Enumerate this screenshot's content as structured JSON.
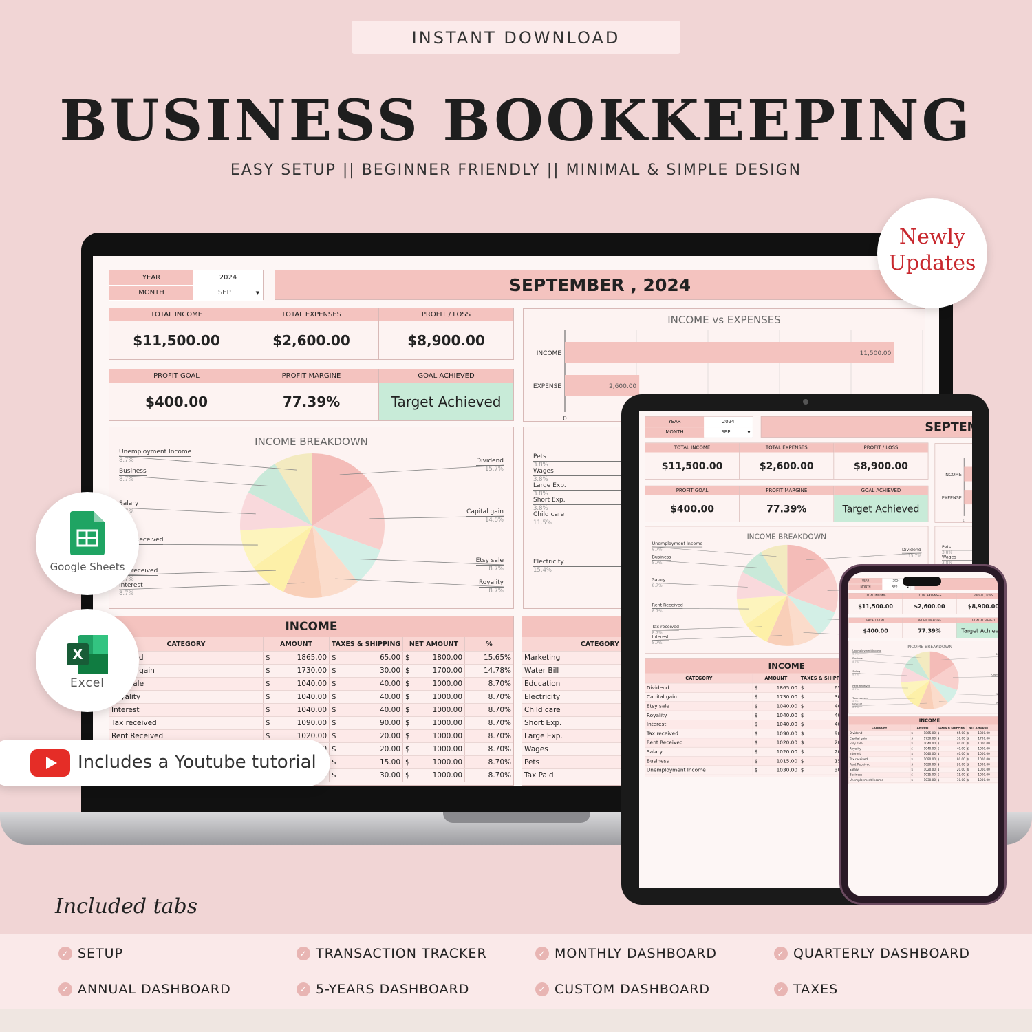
{
  "header": {
    "badge": "INSTANT  DOWNLOAD",
    "title": "BUSINESS  BOOKKEEPING",
    "subtitle": "EASY SETUP || BEGINNER FRIENDLY || MINIMAL & SIMPLE DESIGN"
  },
  "badges": {
    "newly": "Newly",
    "updates": "Updates",
    "google_sheets": "Google Sheets",
    "excel": "Excel",
    "youtube": "Includes a Youtube tutorial"
  },
  "dashboard": {
    "year_label": "YEAR",
    "year": "2024",
    "month_label": "MONTH",
    "month": "SEP",
    "title": "SEPTEMBER , 2024",
    "kpis": [
      {
        "label": "TOTAL INCOME",
        "value": "$11,500.00"
      },
      {
        "label": "TOTAL  EXPENSES",
        "value": "$2,600.00"
      },
      {
        "label": "PROFIT / LOSS",
        "value": "$8,900.00"
      },
      {
        "label": "PROFIT GOAL",
        "value": "$400.00"
      },
      {
        "label": "PROFIT MARGINE",
        "value": "77.39%"
      },
      {
        "label": "GOAL ACHIEVED",
        "value": "Target Achieved"
      }
    ],
    "colors": {
      "accent": "#f4c3bf",
      "achieved": "#c8ebd8",
      "background": "#f1d5d5"
    }
  },
  "chart_data": [
    {
      "type": "bar",
      "title": "INCOME vs EXPENSES",
      "orientation": "horizontal",
      "categories": [
        "INCOME",
        "EXPENSE"
      ],
      "values": [
        11500,
        2600
      ],
      "data_labels": [
        "11,500.00",
        "2,600.00"
      ],
      "xlim": [
        0,
        12500
      ],
      "x_tick_labels": [
        "0"
      ],
      "grid": true,
      "color": "#f4c3bf"
    },
    {
      "type": "pie",
      "title": "INCOME BREAKDOWN",
      "labels": [
        "Dividend",
        "Capital gain",
        "Etsy sale",
        "Royality",
        "Interest",
        "Tax received",
        "Rent Received",
        "Salary",
        "Business",
        "Unemployment Income"
      ],
      "values": [
        15.7,
        14.8,
        8.7,
        8.7,
        8.7,
        8.7,
        8.7,
        8.7,
        8.7,
        8.7
      ],
      "pct_labels": [
        "15.7%",
        "14.8%",
        "8.7%",
        "8.7%",
        "8.7%",
        "8.7%",
        "8.7%",
        "8.7%",
        "8.7%",
        "8.7%"
      ],
      "colors": [
        "#f4bcb8",
        "#f8cfcc",
        "#d3efe6",
        "#fbdccb",
        "#f9cfb8",
        "#fdf0a8",
        "#fdf4bd",
        "#f9d9dc",
        "#c9e9d9",
        "#f3eac0"
      ]
    },
    {
      "type": "pie",
      "title": "",
      "labels": [
        "Pets",
        "Wages",
        "Large Exp.",
        "Short Exp.",
        "Child care",
        "Electricity"
      ],
      "pct_labels": [
        "3.8%",
        "3.8%",
        "3.8%",
        "3.8%",
        "11.5%",
        "15.4%"
      ]
    }
  ],
  "income_table": {
    "title": "INCOME",
    "columns": [
      "CATEGORY",
      "AMOUNT",
      "TAXES & SHIPPING",
      "NET AMOUNT",
      "%"
    ],
    "currency": "$",
    "rows": [
      {
        "category": "Dividend",
        "amount": "1865.00",
        "taxes": "65.00",
        "net": "1800.00",
        "pct": "15.65%"
      },
      {
        "category": "Capital gain",
        "amount": "1730.00",
        "taxes": "30.00",
        "net": "1700.00",
        "pct": "14.78%"
      },
      {
        "category": "Etsy sale",
        "amount": "1040.00",
        "taxes": "40.00",
        "net": "1000.00",
        "pct": "8.70%"
      },
      {
        "category": "Royality",
        "amount": "1040.00",
        "taxes": "40.00",
        "net": "1000.00",
        "pct": "8.70%"
      },
      {
        "category": "Interest",
        "amount": "1040.00",
        "taxes": "40.00",
        "net": "1000.00",
        "pct": "8.70%"
      },
      {
        "category": "Tax received",
        "amount": "1090.00",
        "taxes": "90.00",
        "net": "1000.00",
        "pct": "8.70%"
      },
      {
        "category": "Rent Received",
        "amount": "1020.00",
        "taxes": "20.00",
        "net": "1000.00",
        "pct": "8.70%"
      },
      {
        "category": "Salary",
        "amount": "1020.00",
        "taxes": "20.00",
        "net": "1000.00",
        "pct": "8.70%"
      },
      {
        "category": "Business",
        "amount": "1015.00",
        "taxes": "15.00",
        "net": "1000.00",
        "pct": "8.70%"
      },
      {
        "category": "Unemployment Income",
        "amount": "1030.00",
        "taxes": "30.00",
        "net": "1000.00",
        "pct": "8.70%"
      }
    ]
  },
  "expense_table": {
    "column": "CATEGORY",
    "rows": [
      "Marketing",
      "Water Bill",
      "Education",
      "Electricity",
      "Child care",
      "Short Exp.",
      "Large Exp.",
      "Wages",
      "Pets",
      "Tax Paid"
    ]
  },
  "included": {
    "heading": "Included tabs",
    "tabs": [
      "SETUP",
      "TRANSACTION TRACKER",
      "MONTHLY DASHBOARD",
      "QUARTERLY DASHBOARD",
      "ANNUAL DASHBOARD",
      "5-YEARS DASHBOARD",
      "CUSTOM DASHBOARD",
      "TAXES"
    ]
  }
}
